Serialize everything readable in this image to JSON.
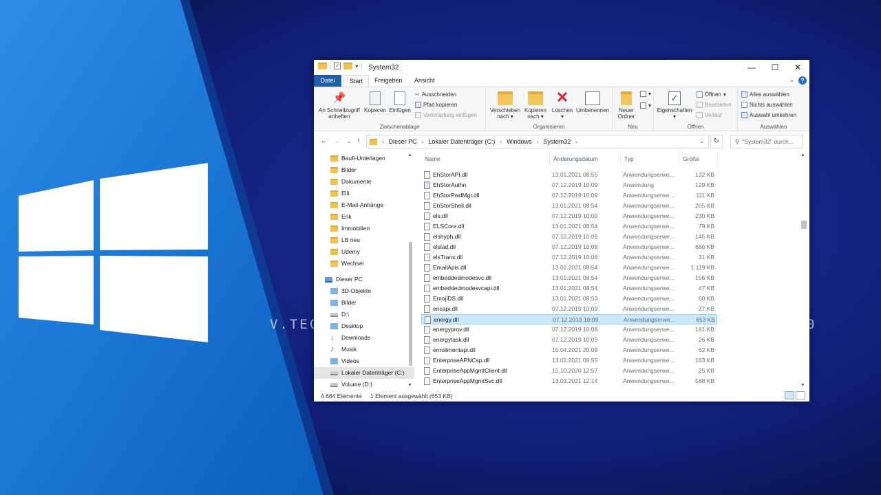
{
  "background": {
    "text_left": "V.TEC",
    "text_right": "0",
    "accent_color": "#1472d2"
  },
  "window": {
    "title": "System32",
    "controls": {
      "minimize": "—",
      "maximize": "☐",
      "close": "✕"
    }
  },
  "tabs": {
    "file": "Datei",
    "start": "Start",
    "share": "Freigeben",
    "view": "Ansicht"
  },
  "ribbon": {
    "clipboard": {
      "label": "Zwischenablage",
      "pin": "An Schnellzugriff anheften",
      "copy": "Kopieren",
      "paste": "Einfügen",
      "cut": "Ausschneiden",
      "copy_path": "Pfad kopieren",
      "paste_shortcut": "Verknüpfung einfügen"
    },
    "organize": {
      "label": "Organisieren",
      "move_to": "Verschieben nach",
      "copy_to": "Kopieren nach",
      "delete": "Löschen",
      "rename": "Umbenennen"
    },
    "new": {
      "label": "Neu",
      "new_folder": "Neuer Ordner"
    },
    "open": {
      "label": "Öffnen",
      "properties": "Eigenschaften",
      "open": "Öffnen",
      "edit": "Bearbeiten",
      "history": "Verlauf"
    },
    "select": {
      "label": "Auswählen",
      "select_all": "Alles auswählen",
      "select_none": "Nichts auswählen",
      "invert": "Auswahl umkehren"
    }
  },
  "address": {
    "parts": [
      "Dieser PC",
      "Lokaler Datenträger (C:)",
      "Windows",
      "System32"
    ],
    "search_placeholder": "\"System32\" durch..."
  },
  "nav_items": [
    {
      "label": "Baufi-Unterlagen",
      "icon": "folder-icon"
    },
    {
      "label": "Bilder",
      "icon": "folder-icon"
    },
    {
      "label": "Dokumente",
      "icon": "folder-icon"
    },
    {
      "label": "Elli",
      "icon": "folder-icon"
    },
    {
      "label": "E-Mail-Anhänge",
      "icon": "folder-icon"
    },
    {
      "label": "Erik",
      "icon": "folder-icon"
    },
    {
      "label": "Immobilien",
      "icon": "folder-icon"
    },
    {
      "label": "LB neu",
      "icon": "folder-icon"
    },
    {
      "label": "Udemy",
      "icon": "folder-icon"
    },
    {
      "label": "Wechsel",
      "icon": "folder-icon"
    },
    {
      "label": "Dieser PC",
      "icon": "pc-icon"
    },
    {
      "label": "3D-Objekte",
      "icon": "cube-icon"
    },
    {
      "label": "Bilder",
      "icon": "pictures-icon"
    },
    {
      "label": "D:\\",
      "icon": "drive-icon"
    },
    {
      "label": "Desktop",
      "icon": "desktop-icon"
    },
    {
      "label": "Downloads",
      "icon": "download-icon"
    },
    {
      "label": "Musik",
      "icon": "music-icon"
    },
    {
      "label": "Videos",
      "icon": "video-icon"
    },
    {
      "label": "Lokaler Datenträger (C:)",
      "icon": "drive-icon",
      "selected": true
    },
    {
      "label": "Volume (D:)",
      "icon": "drive-icon"
    }
  ],
  "columns": {
    "name": "Name",
    "date": "Änderungsdatum",
    "type": "Typ",
    "size": "Größe"
  },
  "files": [
    {
      "name": "EhStorAPI.dll",
      "date": "13.01.2021 08:55",
      "type": "Anwendungserwe...",
      "size": "132 KB"
    },
    {
      "name": "EhStorAuthn",
      "date": "07.12.2019 10:09",
      "type": "Anwendung",
      "size": "129 KB",
      "exe": true
    },
    {
      "name": "EhStorPwdMgr.dll",
      "date": "07.12.2019 10:09",
      "type": "Anwendungserwe...",
      "size": "111 KB"
    },
    {
      "name": "EhStorShell.dll",
      "date": "13.01.2021 08:54",
      "type": "Anwendungserwe...",
      "size": "205 KB"
    },
    {
      "name": "els.dll",
      "date": "07.12.2019 10:09",
      "type": "Anwendungserwe...",
      "size": "230 KB"
    },
    {
      "name": "ELSCore.dll",
      "date": "13.01.2021 08:54",
      "type": "Anwendungserwe...",
      "size": "79 KB"
    },
    {
      "name": "elshyph.dll",
      "date": "07.12.2019 10:09",
      "type": "Anwendungserwe...",
      "size": "145 KB"
    },
    {
      "name": "elslad.dll",
      "date": "07.12.2019 10:08",
      "type": "Anwendungserwe...",
      "size": "686 KB"
    },
    {
      "name": "elsTrans.dll",
      "date": "07.12.2019 10:08",
      "type": "Anwendungserwe...",
      "size": "31 KB"
    },
    {
      "name": "EmailApis.dll",
      "date": "13.01.2021 08:54",
      "type": "Anwendungserwe...",
      "size": "1.119 KB"
    },
    {
      "name": "embeddedmodesvc.dll",
      "date": "13.01.2021 08:54",
      "type": "Anwendungserwe...",
      "size": "156 KB"
    },
    {
      "name": "embeddedmodesvcapi.dll",
      "date": "13.01.2021 08:54",
      "type": "Anwendungserwe...",
      "size": "47 KB"
    },
    {
      "name": "EmojiDS.dll",
      "date": "13.01.2021 08:53",
      "type": "Anwendungserwe...",
      "size": "60 KB"
    },
    {
      "name": "encapi.dll",
      "date": "07.12.2019 10:09",
      "type": "Anwendungserwe...",
      "size": "27 KB"
    },
    {
      "name": "energy.dll",
      "date": "07.12.2019 10:09",
      "type": "Anwendungserwe...",
      "size": "653 KB",
      "selected": true
    },
    {
      "name": "energyprov.dll",
      "date": "07.12.2019 10:08",
      "type": "Anwendungserwe...",
      "size": "181 KB"
    },
    {
      "name": "energytask.dll",
      "date": "07.12.2019 10:09",
      "type": "Anwendungserwe...",
      "size": "26 KB"
    },
    {
      "name": "enrollmentapi.dll",
      "date": "15.04.2021 20:08",
      "type": "Anwendungserwe...",
      "size": "62 KB"
    },
    {
      "name": "EnterpriseAPNCsp.dll",
      "date": "13.01.2021 08:55",
      "type": "Anwendungserwe...",
      "size": "163 KB"
    },
    {
      "name": "EnterpriseAppMgmtClient.dll",
      "date": "15.10.2020 12:57",
      "type": "Anwendungserwe...",
      "size": "25 KB"
    },
    {
      "name": "EnterpriseAppMgmtSvc.dll",
      "date": "13.03.2021 12:14",
      "type": "Anwendungserwe...",
      "size": "588 KB"
    }
  ],
  "status": {
    "count": "4.684 Elemente",
    "selection": "1 Element ausgewählt (653 KB)"
  }
}
